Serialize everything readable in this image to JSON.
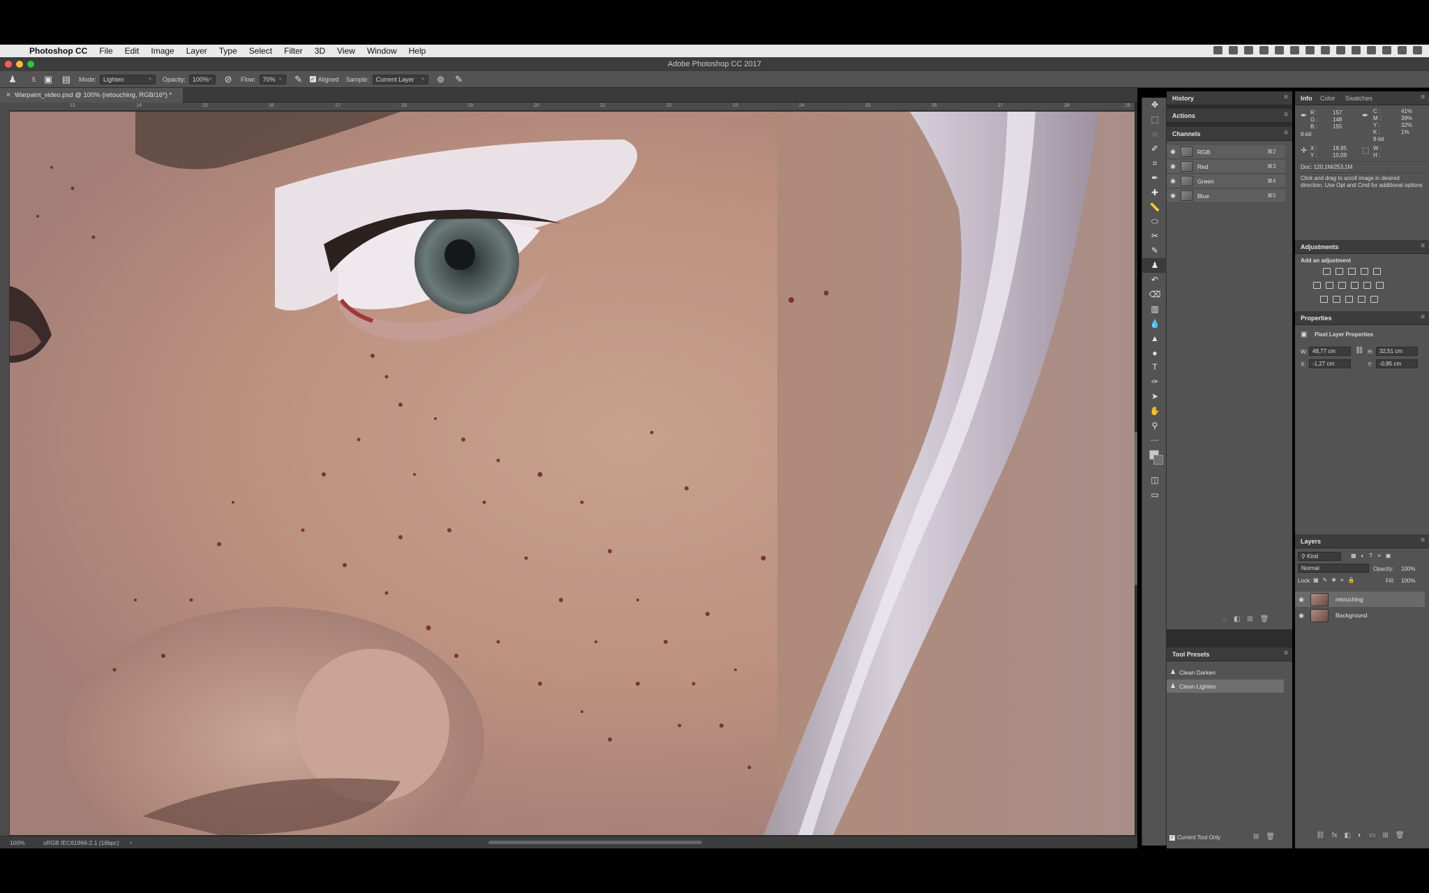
{
  "menubar": {
    "app_name": "Photoshop CC",
    "items": [
      "File",
      "Edit",
      "Image",
      "Layer",
      "Type",
      "Select",
      "Filter",
      "3D",
      "View",
      "Window",
      "Help"
    ]
  },
  "window": {
    "title": "Adobe Photoshop CC 2017"
  },
  "options_bar": {
    "brush_size": "5",
    "mode_label": "Mode:",
    "mode_value": "Lighten",
    "opacity_label": "Opacity:",
    "opacity_value": "100%",
    "flow_label": "Flow:",
    "flow_value": "70%",
    "aligned_label": "Aligned",
    "sample_label": "Sample:",
    "sample_value": "Current Layer"
  },
  "document": {
    "tab_title": "Warpaint_video.psd @ 100% (retouching, RGB/16*) *",
    "ruler_ticks": [
      "13",
      "14",
      "15",
      "16",
      "17",
      "18",
      "19",
      "20",
      "21",
      "22",
      "23",
      "24",
      "25",
      "26",
      "27",
      "28",
      "29"
    ],
    "zoom": "100%",
    "color_profile": "sRGB IEC61966-2.1 (16bpc)",
    "status_arrow": "›"
  },
  "panels": {
    "history": {
      "title": "History"
    },
    "actions": {
      "title": "Actions"
    },
    "channels": {
      "title": "Channels",
      "rows": [
        {
          "name": "RGB",
          "shortcut": "⌘2"
        },
        {
          "name": "Red",
          "shortcut": "⌘3"
        },
        {
          "name": "Green",
          "shortcut": "⌘4"
        },
        {
          "name": "Blue",
          "shortcut": "⌘5"
        }
      ]
    },
    "tool_presets": {
      "title": "Tool Presets",
      "rows": [
        {
          "name": "Clean Darken"
        },
        {
          "name": "Clean Lighten"
        }
      ],
      "current_tool_only": "Current Tool Only"
    },
    "info": {
      "tabs": [
        "Info",
        "Color",
        "Swatches"
      ],
      "rgb_labels": [
        "R :",
        "G :",
        "B :"
      ],
      "rgb_values": [
        "157",
        "148",
        "155"
      ],
      "cmyk_labels": [
        "C :",
        "M :",
        "Y :",
        "K :"
      ],
      "cmyk_values": [
        "41%",
        "39%",
        "32%",
        "1%"
      ],
      "bit_left": "8-bit",
      "bit_right": "8-bit",
      "x_label": "X :",
      "y_label": "Y :",
      "x_value": "18,95",
      "y_value": "10,09",
      "w_label": "W :",
      "h_label": "H :",
      "doc": "Doc: 120,1M/253,1M",
      "hint": "Click and drag to scroll image in desired direction. Use Opt and Cmd for additional options"
    },
    "adjustments": {
      "title": "Adjustments",
      "subtitle": "Add an adjustment"
    },
    "properties": {
      "title": "Properties",
      "subtitle": "Pixel Layer Properties",
      "w_label": "W:",
      "w_value": "48,77 cm",
      "h_label": "H:",
      "h_value": "32,51 cm",
      "x_label": "X:",
      "x_value": "-1,27 cm",
      "y_label": "Y:",
      "y_value": "-0,85 cm"
    },
    "layers": {
      "title": "Layers",
      "kind": "Kind",
      "blend": "Normal",
      "opacity_label": "Opacity:",
      "opacity_value": "100%",
      "lock_label": "Lock:",
      "fill_label": "Fill:",
      "fill_value": "100%",
      "rows": [
        {
          "name": "retouching"
        },
        {
          "name": "Background"
        }
      ]
    }
  },
  "colors": {
    "panel_bg": "#535353",
    "panel_header": "#3c3c3c",
    "selected_row": "#6a6a6a",
    "close": "#fc5f57",
    "minimize": "#fdbc2e",
    "zoom": "#28c840"
  }
}
